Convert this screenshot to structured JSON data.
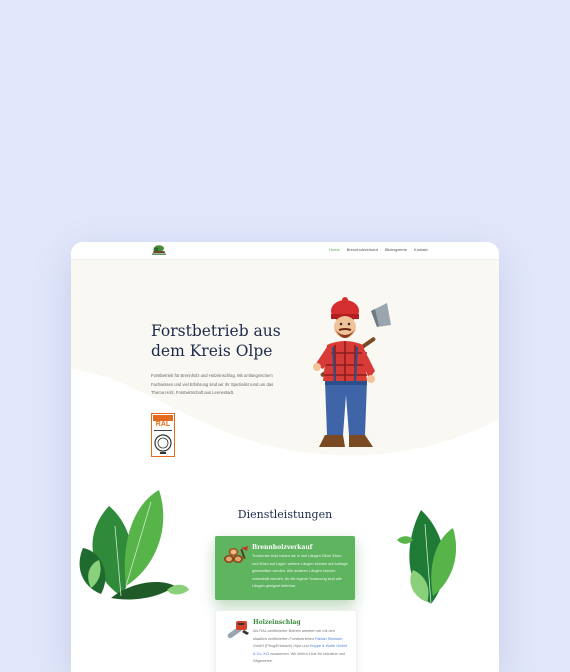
{
  "nav": {
    "items": [
      {
        "label": "Home",
        "active": true
      },
      {
        "label": "Brennholzverkauf",
        "active": false
      },
      {
        "label": "Bildergalerie",
        "active": false
      },
      {
        "label": "Kontakt",
        "active": false
      }
    ]
  },
  "hero": {
    "title_line1": "Forstbetrieb aus",
    "title_line2": "dem Kreis Olpe",
    "text": "Forstbetrieb für Brennholz und Holzeinschlag. Mit umfangreichem Fachwissen und viel Erfahrung sind wir Ihr Spezialist rund um das Thema Holz, Forstwirtschaft aus Lennestadt.",
    "badge_text": "RAL"
  },
  "services": {
    "title": "Dienstleistungen",
    "cards": [
      {
        "title": "Brennholzverkauf",
        "text": "Trockenes Holz haben wir in drei Längen 25cm 33cm und 50cm auf Lager, weitere Längen können auf Anfrage geschnitten werden. Alle anderen Längen können vorbestellt werden, für die eigene Trocknung sind alle Längen geeignet lieferbar.",
        "icon": "firewood-icon",
        "variant": "green"
      },
      {
        "title": "Holzeinschlag",
        "text_before_link": "Als RAL-zertifizierter Betrieb arbeiten wir mit den staatlich zertifizierten Forstbetrieben",
        "link1": "Fabian Simbach",
        "text_mid": "GmbH (Pflug/Ertsbach) Olpe und",
        "link2": "Hoppe & Wolfe GmbH & Co. KG",
        "text_after": "zusammen. Wir liefern Holz für Industrie und Sägewerke.",
        "icon": "chainsaw-icon",
        "variant": "white"
      }
    ]
  },
  "colors": {
    "background": "#e2e7fb",
    "title": "#1d2a4a",
    "accent_green": "#5eb45f",
    "badge_orange": "#e36c1e",
    "link": "#4a7fd6"
  }
}
